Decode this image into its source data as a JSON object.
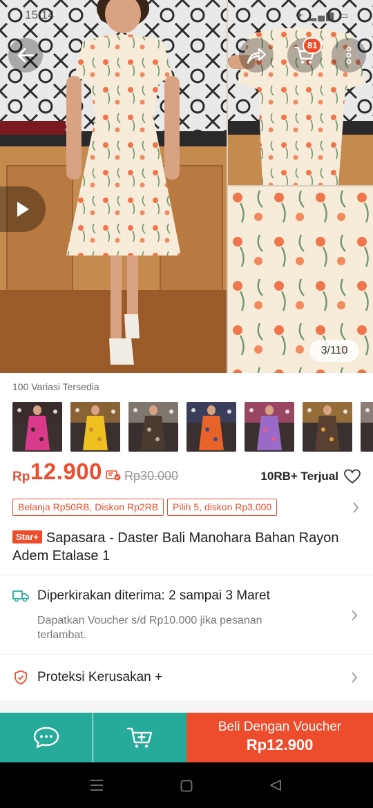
{
  "status_bar": {
    "time": "15:14",
    "icons_text": "✈ ▂▄▆ ▭"
  },
  "header": {
    "cart_count": "81",
    "image_counter": "3/110"
  },
  "variations": {
    "title": "100 Variasi Tersedia",
    "thumbnails": [
      {
        "color_primary": "#d93a8a",
        "color_secondary": "#3a2a2a"
      },
      {
        "color_primary": "#f0c020",
        "color_secondary": "#c98a3a"
      },
      {
        "color_primary": "#4a3a30",
        "color_secondary": "#b8b0a0"
      },
      {
        "color_primary": "#e8632a",
        "color_secondary": "#3a4a80"
      },
      {
        "color_primary": "#9a6ac8",
        "color_secondary": "#e85a90"
      },
      {
        "color_primary": "#5a4030",
        "color_secondary": "#e0a040"
      },
      {
        "color_primary": "#8a6a60",
        "color_secondary": "#d0c0b0"
      }
    ]
  },
  "price": {
    "currency": "Rp",
    "current": "12.900",
    "original": "Rp30.000",
    "sold": "10RB+ Terjual"
  },
  "promos": [
    "Belanja Rp50RB, Diskon Rp2RB",
    "Pilih 5, diskon Rp3.000"
  ],
  "product": {
    "badge": "Star+",
    "title": "Sapasara - Daster Bali Manohara Bahan Rayon Adem Etalase 1"
  },
  "shipping": {
    "estimate": "Diperkirakan diterima: 2 sampai 3 Maret",
    "voucher_note": "Dapatkan Voucher s/d Rp10.000 jika pesanan terlambat."
  },
  "protection": {
    "label": "Proteksi Kerusakan +"
  },
  "action_bar": {
    "buy_label": "Beli Dengan Voucher",
    "buy_price": "Rp12.900"
  },
  "colors": {
    "brand_orange": "#ee4d2d",
    "teal": "#26aa99"
  },
  "icons": [
    "back-arrow-icon",
    "share-icon",
    "cart-icon",
    "more-vert-icon",
    "play-icon",
    "voucher-tag-icon",
    "heart-icon",
    "chevron-right-icon",
    "truck-icon",
    "shield-icon",
    "chat-icon",
    "add-to-cart-icon",
    "nav-menu-icon",
    "nav-home-icon",
    "nav-back-icon"
  ]
}
